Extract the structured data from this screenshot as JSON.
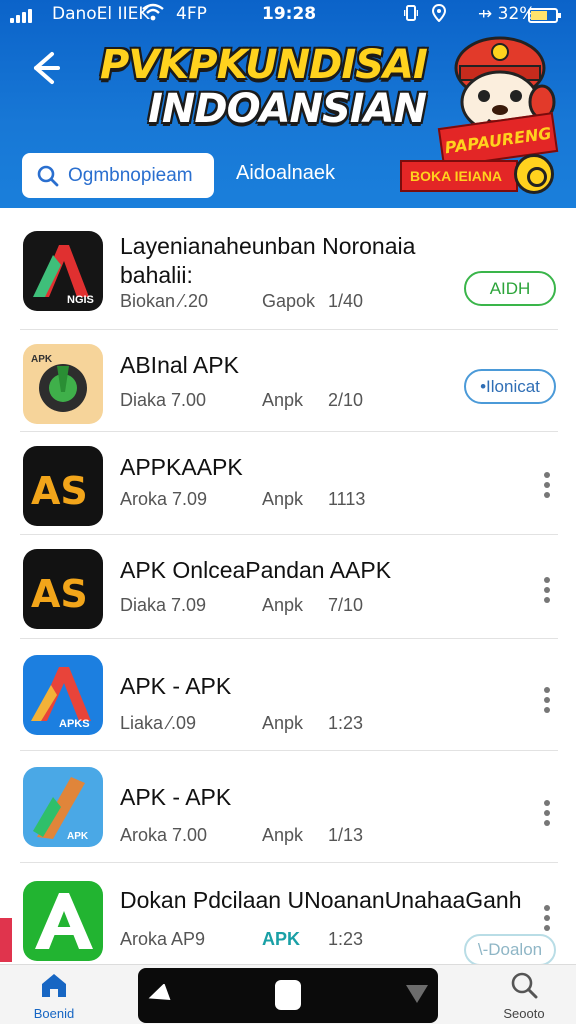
{
  "status_bar": {
    "carrier": "DanoEl IIEK",
    "network": "4FP",
    "time": "19:28",
    "battery_text": "⇸ 32%"
  },
  "header": {
    "title_line1": "PVKPKUNDISAI",
    "title_line2": "INDOANSIAN",
    "promo_top": "PAPAURENG",
    "promo_bottom": "BOKA IEIANA",
    "search_placeholder": "Ogmbnopieam",
    "link": "Aidoalnaek",
    "colors": {
      "header_bg": "#1878d6",
      "title_yellow": "#ffd21e",
      "promo_red": "#e32626"
    }
  },
  "apps": [
    {
      "name": "Layenianaheunban Noronaia bahalii:",
      "meta": [
        "Biokan ⁄.20",
        "Gapok",
        "1/40"
      ],
      "action": {
        "type": "button",
        "label": "AIDH",
        "style": "green"
      }
    },
    {
      "name": "ABInal APK",
      "meta": [
        "Diaka 7.00",
        "Anpk",
        "2/10"
      ],
      "action": {
        "type": "button",
        "label": "•Ilonicat",
        "style": "blue"
      }
    },
    {
      "name": "APPKAAPK",
      "meta": [
        "Aroka 7.09",
        "Anpk",
        "1113"
      ],
      "action": {
        "type": "more",
        "icon": "more-vertical-icon"
      }
    },
    {
      "name": "APK OnlceaPandan AAPK",
      "meta": [
        "Diaka 7.09",
        "Anpk",
        "7/10"
      ],
      "action": {
        "type": "more",
        "icon": "more-vertical-icon"
      }
    },
    {
      "name": "APK - APK",
      "meta": [
        "Liaka ⁄.09",
        "Anpk",
        "1:23"
      ],
      "action": {
        "type": "more",
        "icon": "more-vertical-icon"
      }
    },
    {
      "name": "APK - APK",
      "meta": [
        "Aroka 7.00",
        "Anpk",
        "1/13"
      ],
      "action": {
        "type": "more",
        "icon": "more-vertical-icon"
      }
    },
    {
      "name": "Dokan Pdcilaan UNoananUnahaaGanh",
      "meta": [
        "Aroka AP9",
        "APK",
        "1:23"
      ],
      "action": {
        "type": "button",
        "label": "\\-Doalon",
        "style": "faded"
      }
    }
  ],
  "bottom_nav": {
    "home_label": "Boenid",
    "search_label": "Seooto"
  }
}
